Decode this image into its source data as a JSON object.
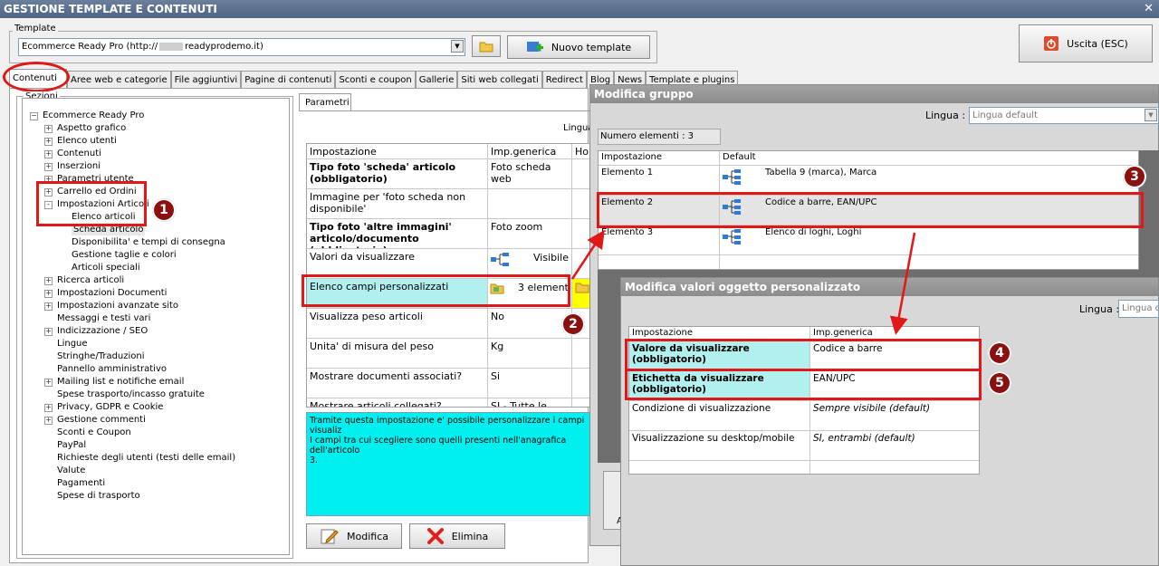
{
  "window": {
    "title": "GESTIONE TEMPLATE E CONTENUTI",
    "close": "✕"
  },
  "template_group": {
    "label": "Template",
    "selected": "Ecommerce Ready Pro (http://",
    "selected_suffix": "readyprodemo.it)",
    "new_button": "Nuovo template"
  },
  "exit_button": "Uscita (ESC)",
  "tabs": [
    "Contenuti",
    "Aree web e categorie",
    "File aggiuntivi",
    "Pagine di contenuti",
    "Sconti e coupon",
    "Gallerie",
    "Siti web collegati",
    "Redirect",
    "Blog",
    "News",
    "Template e plugins"
  ],
  "sections": {
    "label": "Sezioni",
    "root": "Ecommerce Ready Pro",
    "items": [
      {
        "label": "Aspetto grafico",
        "pm": "+"
      },
      {
        "label": "Elenco utenti",
        "pm": "+"
      },
      {
        "label": "Contenuti",
        "pm": "+"
      },
      {
        "label": "Inserzioni",
        "pm": "+"
      },
      {
        "label": "Parametri utente",
        "pm": "+"
      },
      {
        "label": "Carrello ed Ordini",
        "pm": "+"
      },
      {
        "label": "Impostazioni Articoli",
        "pm": "-"
      },
      {
        "label": "Elenco articoli",
        "pm": "",
        "child": true
      },
      {
        "label": "Scheda articolo",
        "pm": "",
        "child": true,
        "selected": true
      },
      {
        "label": "Disponibilita' e tempi di consegna",
        "pm": "",
        "child": true
      },
      {
        "label": "Gestione taglie e colori",
        "pm": "",
        "child": true
      },
      {
        "label": "Articoli speciali",
        "pm": "",
        "child": true
      },
      {
        "label": "Ricerca articoli",
        "pm": "+"
      },
      {
        "label": "Impostazioni Documenti",
        "pm": "+"
      },
      {
        "label": "Impostazioni avanzate sito",
        "pm": "+"
      },
      {
        "label": "Messaggi e testi vari",
        "pm": ""
      },
      {
        "label": "Indicizzazione / SEO",
        "pm": "+"
      },
      {
        "label": "Lingue",
        "pm": ""
      },
      {
        "label": "Stringhe/Traduzioni",
        "pm": ""
      },
      {
        "label": "Pannello amministrativo",
        "pm": ""
      },
      {
        "label": "Mailing list e notifiche email",
        "pm": "+"
      },
      {
        "label": "Spese trasporto/incasso gratuite",
        "pm": ""
      },
      {
        "label": "Privacy, GDPR e Cookie",
        "pm": "+"
      },
      {
        "label": "Gestione commenti",
        "pm": "+"
      },
      {
        "label": "Sconti e Coupon",
        "pm": ""
      },
      {
        "label": "PayPal",
        "pm": ""
      },
      {
        "label": "Richieste degli utenti (testi delle email)",
        "pm": ""
      },
      {
        "label": "Valute",
        "pm": ""
      },
      {
        "label": "Pagamenti",
        "pm": ""
      },
      {
        "label": "Spese di trasporto",
        "pm": ""
      }
    ]
  },
  "params": {
    "tab": "Parametri",
    "lingua_label": "Lingua",
    "headers": [
      "Impostazione",
      "Imp.generica",
      "Hor"
    ],
    "rows": [
      {
        "name": "Tipo foto 'scheda' articolo (obbligatorio)",
        "value": "Foto scheda web",
        "bold": true
      },
      {
        "name": "Immagine per 'foto scheda non disponibile'",
        "value": "",
        "bold": false
      },
      {
        "name": "Tipo foto 'altre immagini' articolo/documento (obbligatorio)",
        "value": "Foto zoom",
        "bold": true
      },
      {
        "name": "Valori da visualizzare",
        "value": "Visibile",
        "bold": false
      },
      {
        "name": "Elenco campi personalizzati",
        "value": "3 elementi",
        "bold": false
      },
      {
        "name": "Visualizza peso articoli",
        "value": "No",
        "bold": false
      },
      {
        "name": "Unita' di misura del peso",
        "value": "Kg",
        "bold": false
      },
      {
        "name": "Mostrare documenti associati?",
        "value": "Si",
        "bold": false
      },
      {
        "name": "Mostrare articoli collegati?",
        "value": "SI - Tutte le",
        "bold": false
      }
    ],
    "description": "Tramite questa impostazione e' possibile personalizzare i campi visualiz\nI campi tra cui scegliere sono quelli presenti nell'anagrafica dell'articolo\n3.",
    "edit_button": "Modifica",
    "delete_button": "Elimina"
  },
  "group_window": {
    "title": "Modifica gruppo",
    "lingua_label": "Lingua :",
    "lingua_value": "Lingua default",
    "count": "Numero elementi : 3",
    "headers": [
      "Impostazione",
      "Default"
    ],
    "rows": [
      {
        "name": "Elemento 1",
        "value": "Tabella 9 (marca), Marca"
      },
      {
        "name": "Elemento 2",
        "value": "Codice a barre, EAN/UPC"
      },
      {
        "name": "Elemento 3",
        "value": "Elenco di loghi, Loghi"
      }
    ],
    "partial_button": "A"
  },
  "custom_window": {
    "title": "Modifica valori oggetto personalizzato",
    "lingua_label": "Lingua :",
    "lingua_value": "Lingua d",
    "headers": [
      "Impostazione",
      "Imp.generica"
    ],
    "rows": [
      {
        "name": "Valore da visualizzare (obbligatorio)",
        "value": "Codice a barre",
        "bold": true,
        "italic": false
      },
      {
        "name": "Etichetta da visualizzare (obbligatorio)",
        "value": "EAN/UPC",
        "bold": true,
        "italic": false
      },
      {
        "name": "Condizione di visualizzazione",
        "value": "Sempre visibile (default)",
        "bold": false,
        "italic": true
      },
      {
        "name": "Visualizzazione su desktop/mobile",
        "value": "SI, entrambi (default)",
        "bold": false,
        "italic": true
      }
    ]
  },
  "badges": [
    "1",
    "2",
    "3",
    "4",
    "5"
  ],
  "colors": {
    "highlight_cyan": "#b2f0f0",
    "annotation_red": "#e01818",
    "badge_red": "#8b1010",
    "description_bg": "#00f0f0"
  }
}
